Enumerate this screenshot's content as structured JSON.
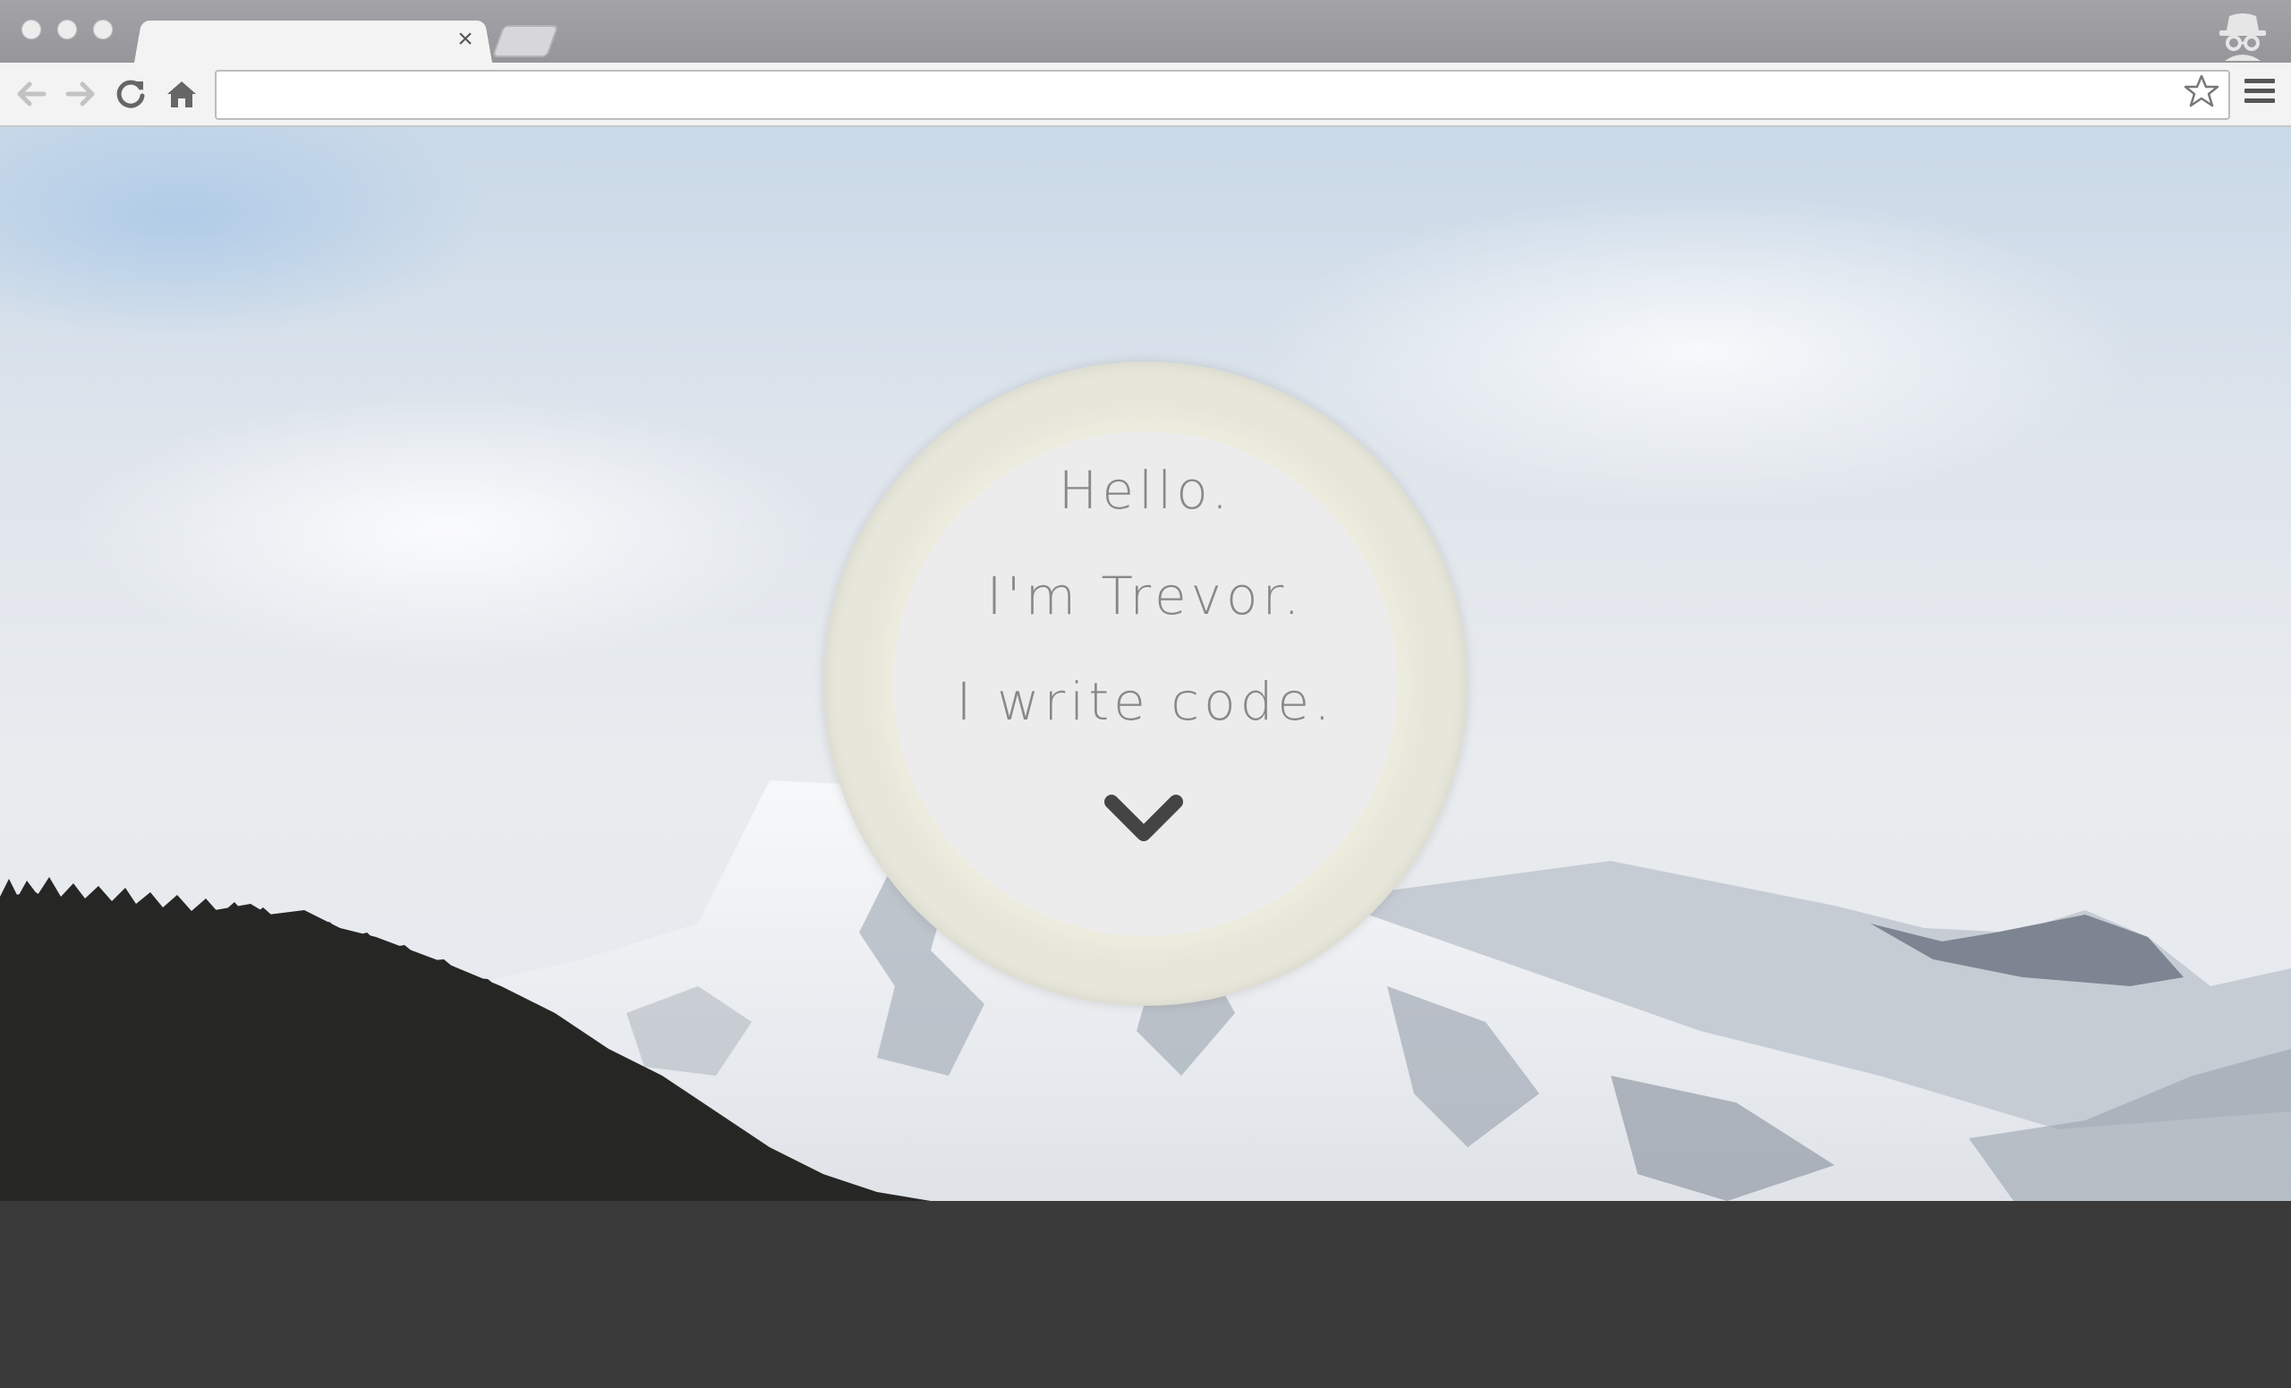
{
  "browser": {
    "active_tab_title": "",
    "close_glyph": "×",
    "address_bar": {
      "value": "",
      "placeholder": ""
    },
    "icons": [
      "back-icon",
      "forward-icon",
      "reload-icon",
      "home-icon",
      "bookmark-star-icon",
      "menu-icon",
      "incognito-icon"
    ]
  },
  "hero": {
    "lines": [
      "Hello.",
      "I'm Trevor.",
      "I write code."
    ],
    "scroll_icon": "chevron-down-icon",
    "colors": {
      "text": "#888888",
      "chevron": "#444444",
      "ring": "#e7e6da",
      "inner": "#ececec"
    }
  },
  "footer": {
    "background": "#3a3a3a"
  }
}
